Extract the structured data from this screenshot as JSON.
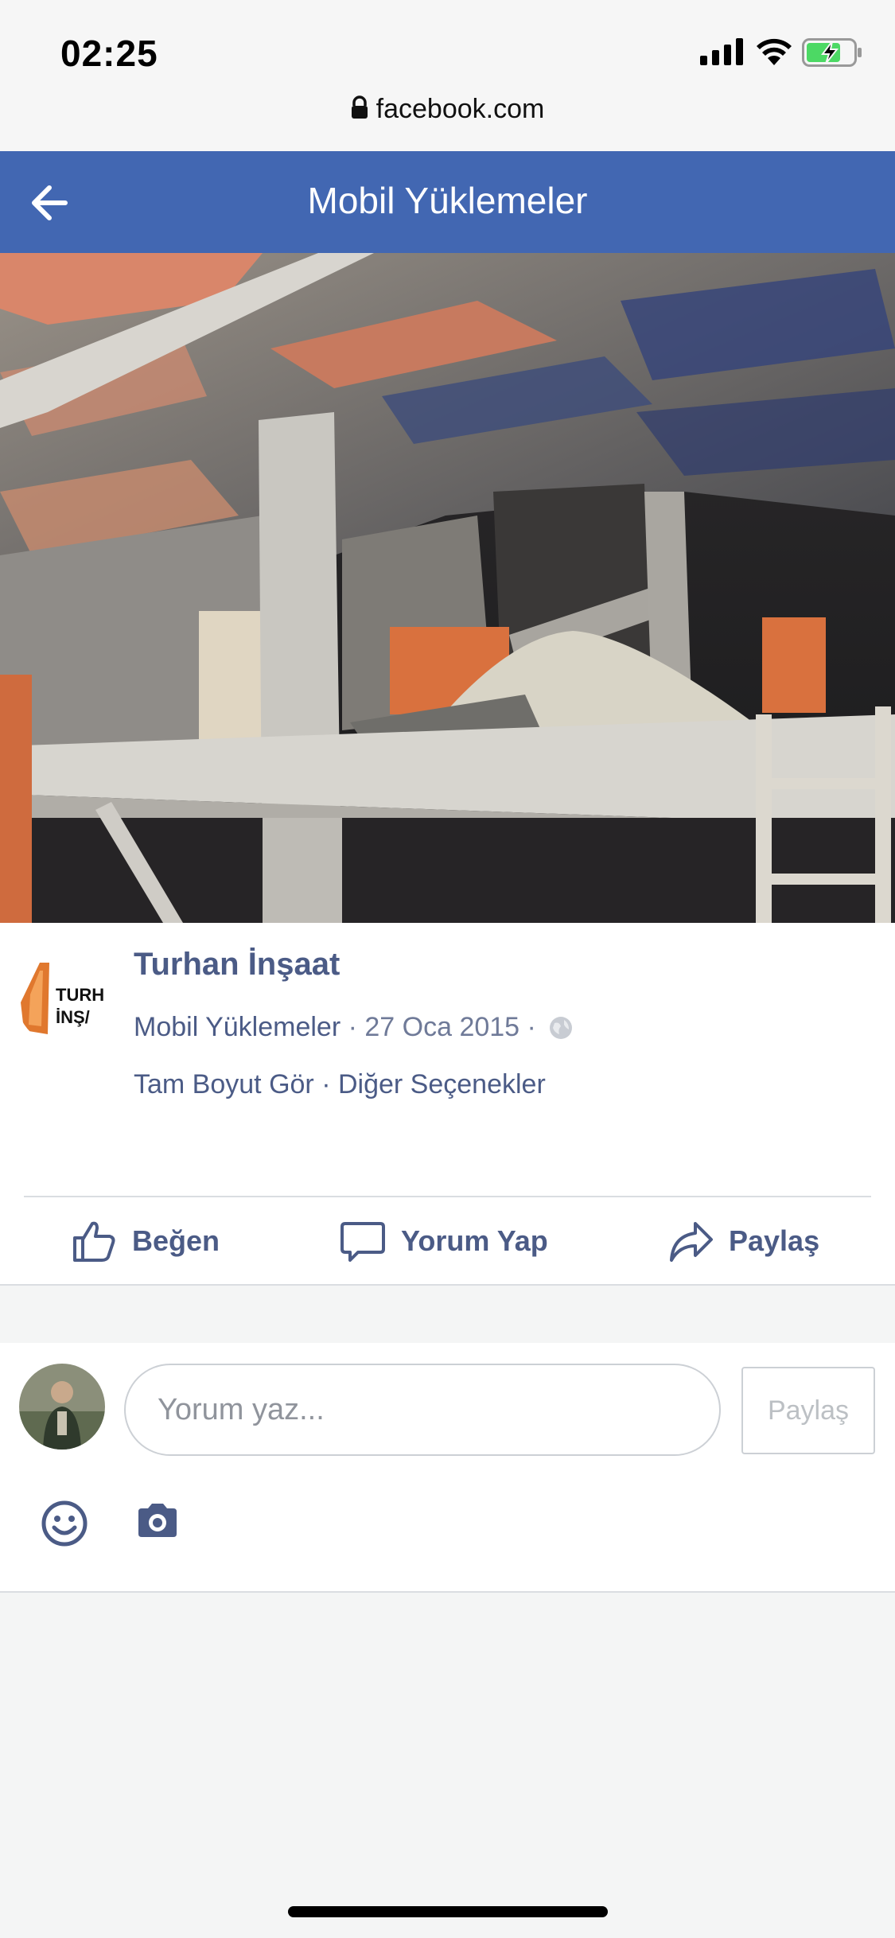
{
  "status_bar": {
    "time": "02:25",
    "url": "facebook.com"
  },
  "nav": {
    "title": "Mobil Yüklemeler",
    "color": "#4267b2"
  },
  "post": {
    "author": "Turhan İnşaat",
    "album": "Mobil Yüklemeler",
    "date_text": " · 27 Oca 2015 · ",
    "full_size": "Tam Boyut Gör",
    "separator": " · ",
    "more_options": "Diğer Seçenekler",
    "avatar_text_line1": "TURH",
    "avatar_text_line2": "İNŞ/"
  },
  "actions": {
    "like": "Beğen",
    "comment": "Yorum Yap",
    "share": "Paylaş"
  },
  "composer": {
    "placeholder": "Yorum yaz...",
    "post_button": "Paylaş"
  },
  "icons": {
    "back": "back-arrow-icon",
    "like": "thumbs-up-icon",
    "comment": "speech-bubble-icon",
    "share": "share-arrow-icon",
    "emoji": "smiley-icon",
    "camera": "camera-icon",
    "privacy": "globe-icon"
  }
}
